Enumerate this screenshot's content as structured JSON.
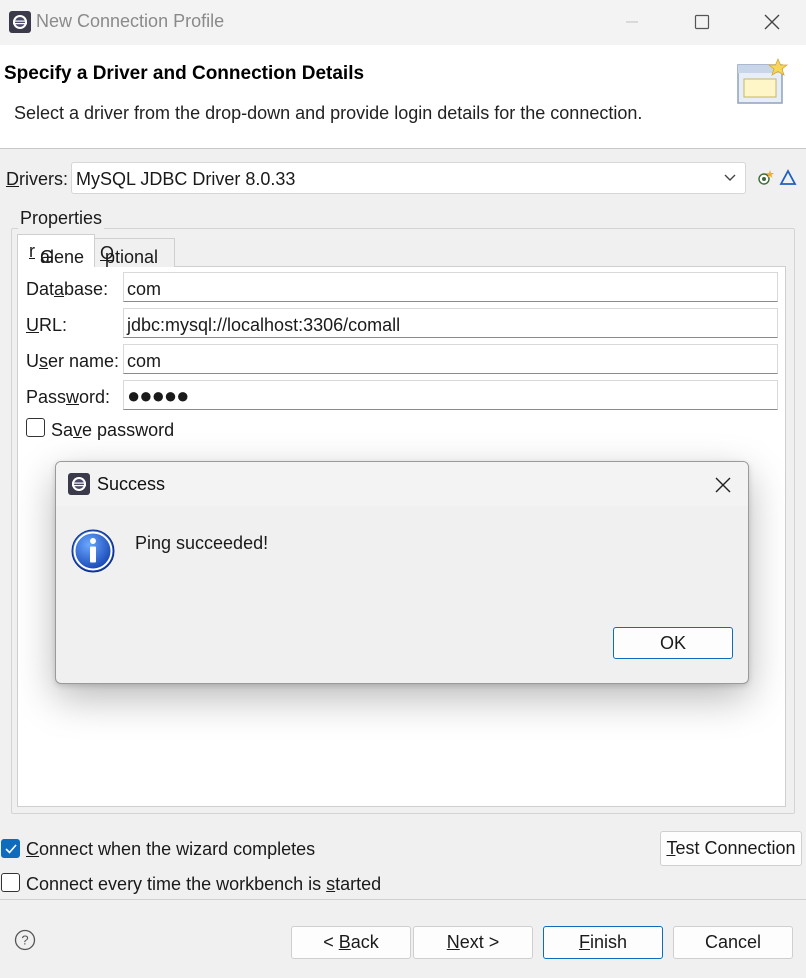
{
  "window": {
    "title": "New Connection Profile"
  },
  "banner": {
    "title": "Specify a Driver and Connection Details",
    "description": "Select a driver from the drop-down and provide login details for the connection."
  },
  "drivers": {
    "label_prefix": "D",
    "label_rest": "rivers:",
    "selected": "MySQL JDBC Driver 8.0.33"
  },
  "properties": {
    "group_label": "Properties",
    "tabs": [
      {
        "pre": "Gene",
        "u": "r",
        "post": "al"
      },
      {
        "pre": "",
        "u": "O",
        "post": "ptional"
      }
    ],
    "fields": [
      {
        "pre": "Dat",
        "u": "a",
        "post": "base:",
        "value": "com"
      },
      {
        "pre": "",
        "u": "U",
        "post": "RL:",
        "value": "jdbc:mysql://localhost:3306/comall"
      },
      {
        "pre": "U",
        "u": "s",
        "post": "er name:",
        "value": "com"
      },
      {
        "pre": "Pass",
        "u": "w",
        "post": "ord:",
        "value": "●●●●●"
      }
    ],
    "save_password": {
      "pre": "Sa",
      "u": "v",
      "post": "e password",
      "checked": false
    }
  },
  "dialog": {
    "title": "Success",
    "message": "Ping succeeded!",
    "ok_label": "OK"
  },
  "options": {
    "connect_on_finish": {
      "u": "C",
      "post": "onnect when the wizard completes",
      "checked": true
    },
    "connect_every_time": {
      "pre": "Connect every time the workbench is ",
      "u": "s",
      "post": "tarted",
      "checked": false
    }
  },
  "buttons": {
    "test_connection": {
      "u": "T",
      "post": "est Connection"
    },
    "back": {
      "pre": "< ",
      "u": "B",
      "post": "ack"
    },
    "next": {
      "u": "N",
      "post": "ext >"
    },
    "finish": {
      "u": "F",
      "post": "inish"
    },
    "cancel": "Cancel"
  },
  "colors": {
    "accent": "#0f6cbd",
    "background": "#f0f0f0"
  }
}
